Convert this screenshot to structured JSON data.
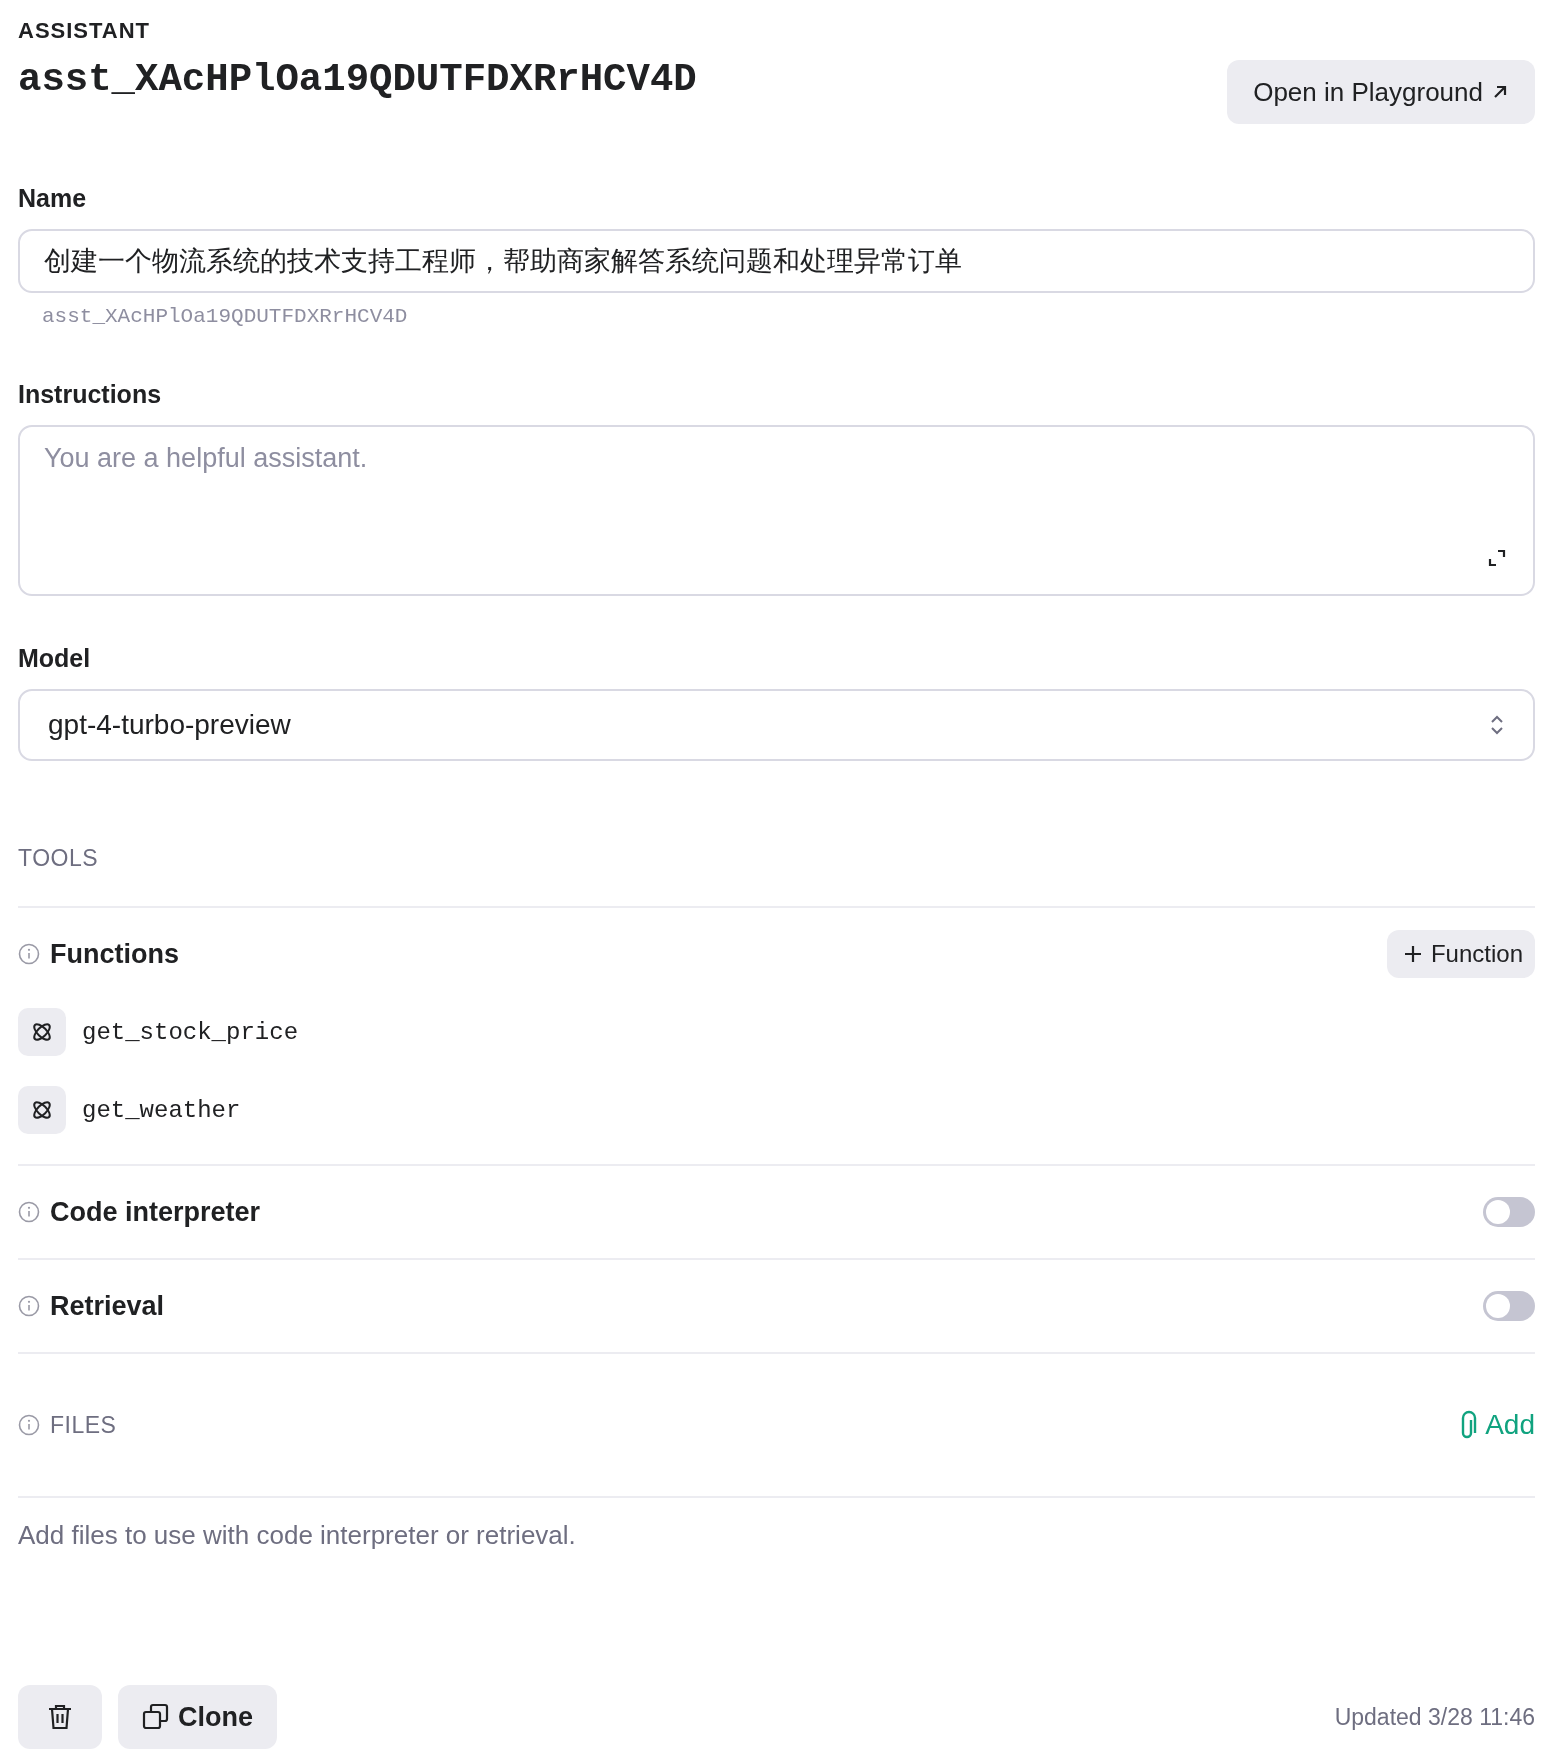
{
  "header": {
    "label": "ASSISTANT",
    "title": "asst_XAcHPlOa19QDUTFDXRrHCV4D",
    "open_button": "Open in Playground"
  },
  "name_field": {
    "label": "Name",
    "value": "创建一个物流系统的技术支持工程师，帮助商家解答系统问题和处理异常订单",
    "id_text": "asst_XAcHPlOa19QDUTFDXRrHCV4D"
  },
  "instructions_field": {
    "label": "Instructions",
    "placeholder": "You are a helpful assistant."
  },
  "model_field": {
    "label": "Model",
    "value": "gpt-4-turbo-preview"
  },
  "tools": {
    "heading": "TOOLS",
    "functions": {
      "label": "Functions",
      "add_button": "Function",
      "items": [
        {
          "name": "get_stock_price"
        },
        {
          "name": "get_weather"
        }
      ]
    },
    "toggles": [
      {
        "label": "Code interpreter",
        "on": false
      },
      {
        "label": "Retrieval",
        "on": false
      }
    ]
  },
  "files": {
    "heading": "FILES",
    "add_button": "Add",
    "empty_text": "Add files to use with code interpreter or retrieval."
  },
  "footer": {
    "clone_button": "Clone",
    "updated": "Updated 3/28 11:46"
  }
}
